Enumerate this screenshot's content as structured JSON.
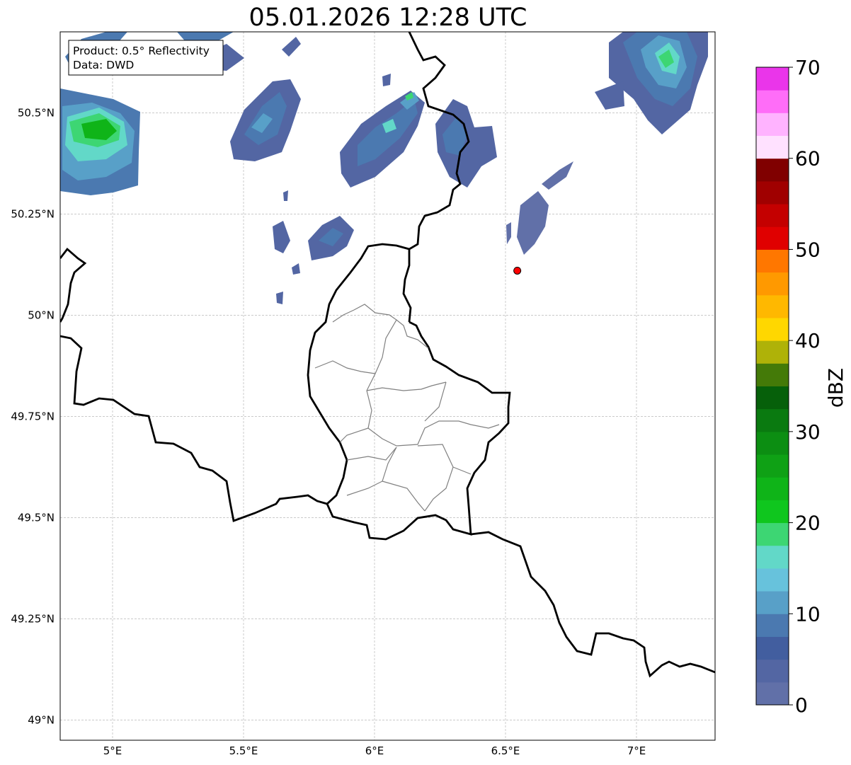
{
  "title": "05.01.2026 12:28 UTC",
  "info_box": {
    "product": "Product: 0.5° Reflectivity",
    "data": "Data: DWD"
  },
  "map": {
    "lon_range": [
      4.8,
      7.3
    ],
    "lat_range": [
      48.95,
      50.7
    ],
    "lon_ticks": [
      {
        "value": 5.0,
        "label": "5°E"
      },
      {
        "value": 5.5,
        "label": "5.5°E"
      },
      {
        "value": 6.0,
        "label": "6°E"
      },
      {
        "value": 6.5,
        "label": "6.5°E"
      },
      {
        "value": 7.0,
        "label": "7°E"
      }
    ],
    "lat_ticks": [
      {
        "value": 50.5,
        "label": "50.5°N"
      },
      {
        "value": 50.25,
        "label": "50.25°N"
      },
      {
        "value": 50.0,
        "label": "50°N"
      },
      {
        "value": 49.75,
        "label": "49.75°N"
      },
      {
        "value": 49.5,
        "label": "49.5°N"
      },
      {
        "value": 49.25,
        "label": "49.25°N"
      },
      {
        "value": 49.0,
        "label": "49°N"
      }
    ],
    "marker": {
      "lon": 6.545,
      "lat": 50.11,
      "color": "#ff0000"
    }
  },
  "colorbar": {
    "label": "dBZ",
    "min": 0,
    "max": 70,
    "ticks": [
      {
        "value": 0,
        "label": "0"
      },
      {
        "value": 10,
        "label": "10"
      },
      {
        "value": 20,
        "label": "20"
      },
      {
        "value": 30,
        "label": "30"
      },
      {
        "value": 40,
        "label": "40"
      },
      {
        "value": 50,
        "label": "50"
      },
      {
        "value": 60,
        "label": "60"
      },
      {
        "value": 70,
        "label": "70"
      }
    ],
    "colors": [
      "#6170a8",
      "#5366a3",
      "#425e9f",
      "#4b79b0",
      "#58a0c8",
      "#67c2dc",
      "#62d8c8",
      "#3dd673",
      "#0fc61e",
      "#0fb418",
      "#0fa115",
      "#0c8e12",
      "#0a7a10",
      "#06600a",
      "#447a08",
      "#afb208",
      "#ffd700",
      "#ffb800",
      "#ff9900",
      "#ff7700",
      "#e00000",
      "#c40000",
      "#a00000",
      "#800000",
      "#ffe1ff",
      "#ffb3ff",
      "#ff6df8",
      "#ea35ea"
    ]
  }
}
